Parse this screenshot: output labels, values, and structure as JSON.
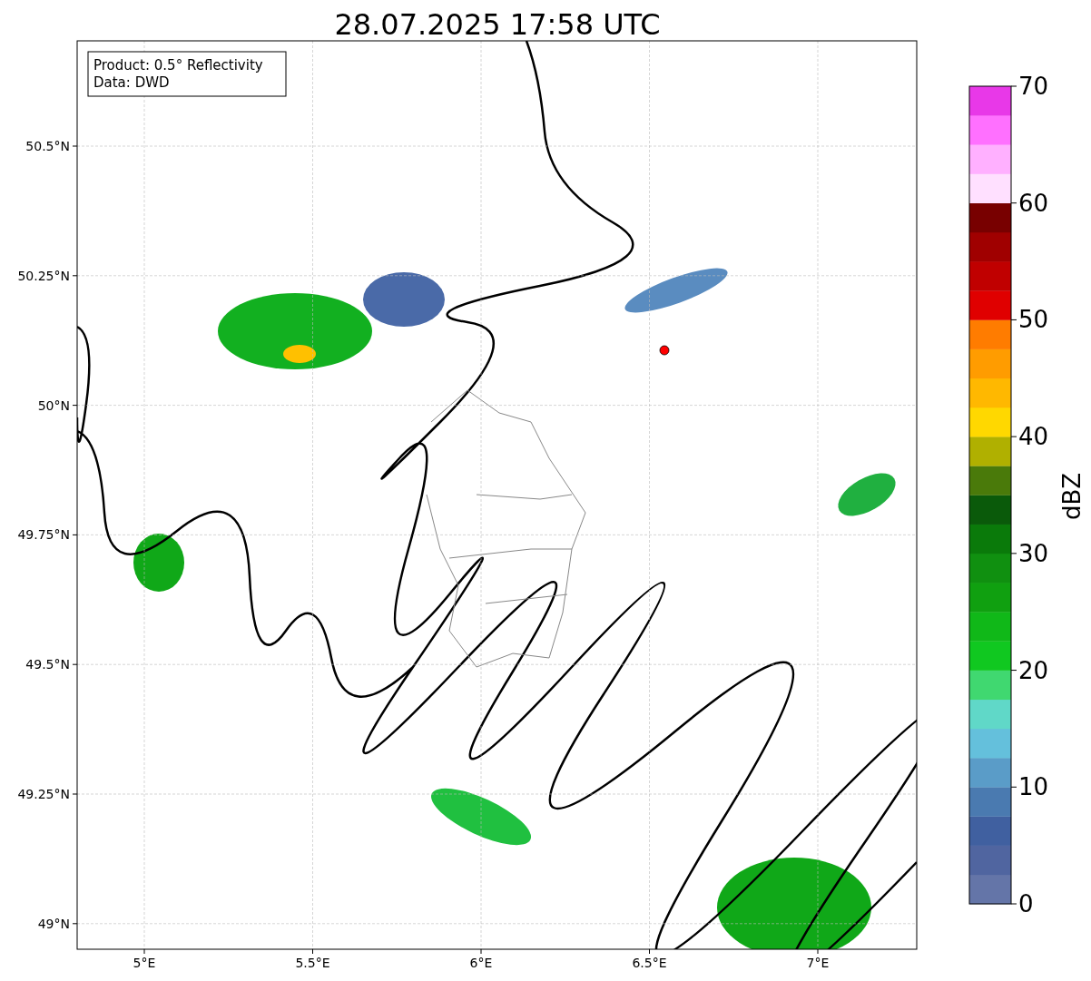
{
  "title": "28.07.2025 17:58 UTC",
  "info_box": [
    "Product: 0.5° Reflectivity",
    "Data: DWD"
  ],
  "map": {
    "y_ticks": [
      "50.5°N",
      "50.25°N",
      "50°N",
      "49.75°N",
      "49.5°N",
      "49.25°N",
      "49°N"
    ],
    "x_ticks": [
      "5°E",
      "5.5°E",
      "6°E",
      "6.5°E",
      "7°E"
    ]
  },
  "colorbar": {
    "label": "dBZ",
    "ticks": [
      "70",
      "60",
      "50",
      "40",
      "30",
      "20",
      "10",
      "0"
    ],
    "bins": [
      {
        "color": "#6475a8"
      },
      {
        "color": "#5065a0"
      },
      {
        "color": "#4060a0"
      },
      {
        "color": "#4a7ab0"
      },
      {
        "color": "#5a9cc8"
      },
      {
        "color": "#64c0dc"
      },
      {
        "color": "#60d8c8"
      },
      {
        "color": "#40d870"
      },
      {
        "color": "#10c820"
      },
      {
        "color": "#10b818"
      },
      {
        "color": "#10a010"
      },
      {
        "color": "#109010"
      },
      {
        "color": "#0a7a0a"
      },
      {
        "color": "#0a5a0a"
      },
      {
        "color": "#4a7a0a"
      },
      {
        "color": "#b0b000"
      },
      {
        "color": "#ffd800"
      },
      {
        "color": "#ffb800"
      },
      {
        "color": "#ff9c00"
      },
      {
        "color": "#ff7c00"
      },
      {
        "color": "#e00000"
      },
      {
        "color": "#c00000"
      },
      {
        "color": "#a00000"
      },
      {
        "color": "#780000"
      },
      {
        "color": "#ffe0ff"
      },
      {
        "color": "#ffb0ff"
      },
      {
        "color": "#ff70ff"
      },
      {
        "color": "#e838e8"
      }
    ]
  }
}
